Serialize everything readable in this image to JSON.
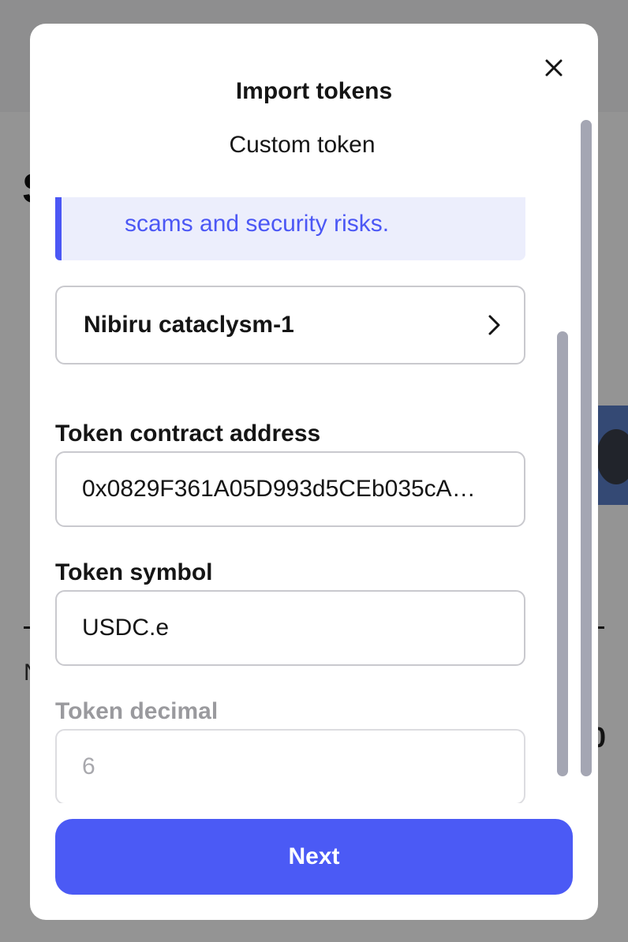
{
  "modal": {
    "title": "Import tokens",
    "section_title": "Custom token",
    "warning_text": "scams and security risks.",
    "chain_selector": {
      "label": "Nibiru cataclysm-1"
    },
    "fields": {
      "contract_address": {
        "label": "Token contract address",
        "value": "0x0829F361A05D993d5CEb035cA…"
      },
      "symbol": {
        "label": "Token symbol",
        "value": "USDC.e"
      },
      "decimal": {
        "label": "Token decimal",
        "value": "6"
      }
    },
    "next_label": "Next"
  },
  "colors": {
    "accent": "#4b5af5",
    "warning_bg": "#eceefc",
    "warning_text": "#4b57f5",
    "muted_text": "#9a9a9e"
  },
  "icons": {
    "close": "close-icon",
    "chevron": "chevron-right-icon"
  }
}
